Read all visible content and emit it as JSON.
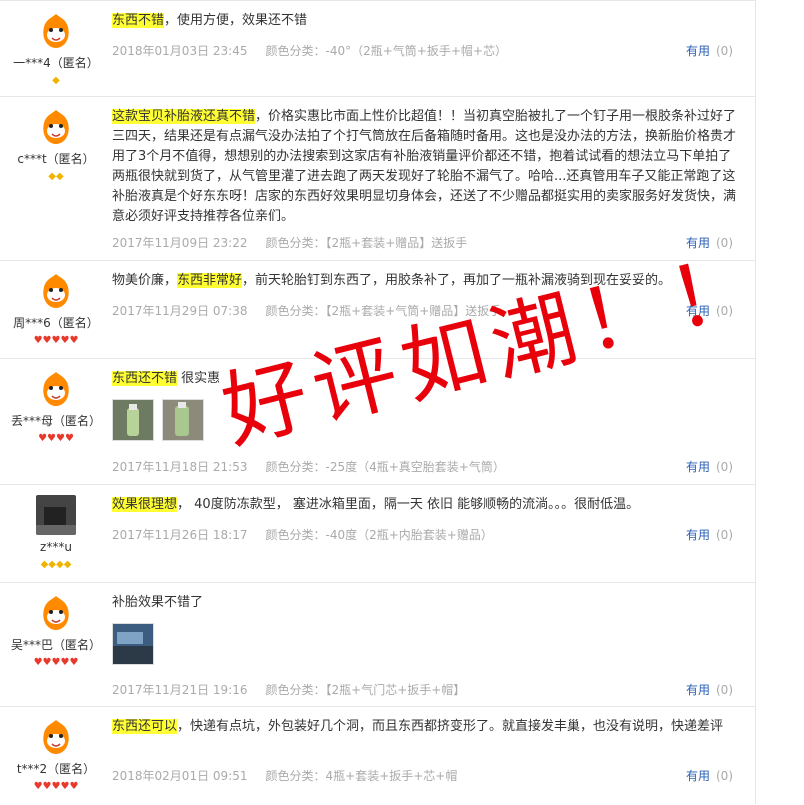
{
  "reviews": [
    {
      "user": "一***4（匿名）",
      "badge_type": "diamond",
      "badge_count": 1,
      "avatar": "orange-mascot-avatar",
      "highlight": "东西不错",
      "text": "，使用方便，效果还不错",
      "prefix": "",
      "date": "2018年01月03日 23:45",
      "color_label": "颜色分类：",
      "color": "-40°（2瓶+气筒+扳手+帽+芯）",
      "useful_label": "有用",
      "useful_count": "(0)"
    },
    {
      "user": "c***t（匿名）",
      "badge_type": "diamond",
      "badge_count": 2,
      "avatar": "orange-mascot-avatar",
      "highlight": "这款宝贝补胎液还真不错",
      "text": "，价格实惠比市面上性价比超值！！当初真空胎被扎了一个钉子用一根胶条补过好了三四天，结果还是有点漏气没办法拍了个打气筒放在后备箱随时备用。这也是没办法的方法，换新胎价格贵才用了3个月不值得，想想别的办法搜索到这家店有补胎液销量评价都还不错，抱着试试看的想法立马下单拍了两瓶很快就到货了，从气管里灌了进去跑了两天发现好了轮胎不漏气了。哈哈...还真管用车子又能正常跑了这补胎液真是个好东东呀！店家的东西好效果明显切身体会，还送了不少赠品都挺实用的卖家服务好发货快，满意必须好评支持推荐各位亲们。",
      "prefix": "",
      "date": "2017年11月09日 23:22",
      "color_label": "颜色分类：",
      "color": "【2瓶+套装+赠品】送扳手",
      "useful_label": "有用",
      "useful_count": "(0)"
    },
    {
      "user": "周***6（匿名）",
      "badge_type": "heart",
      "badge_count": 5,
      "avatar": "orange-mascot-avatar",
      "prefix": "物美价廉，",
      "highlight": "东西非常好",
      "text": "，前天轮胎钉到东西了，用胶条补了，再加了一瓶补漏液骑到现在妥妥的。",
      "date": "2017年11月29日 07:38",
      "color_label": "颜色分类：",
      "color": "【2瓶+套装+气筒+赠品】送扳手",
      "useful_label": "有用",
      "useful_count": "(0)"
    },
    {
      "user": "丢***母（匿名）",
      "badge_type": "heart",
      "badge_count": 4,
      "avatar": "orange-mascot-avatar",
      "prefix": "",
      "highlight": "东西还不错",
      "text": " 很实惠",
      "thumbs": [
        "product-photo-thumbnail",
        "product-photo-thumbnail"
      ],
      "date": "2017年11月18日 21:53",
      "color_label": "颜色分类：",
      "color": "-25度（4瓶+真空胎套装+气筒）",
      "useful_label": "有用",
      "useful_count": "(0)"
    },
    {
      "user": "z***u",
      "badge_type": "diamond",
      "badge_count": 4,
      "avatar": "user-photo-avatar",
      "prefix": "",
      "highlight": "效果很理想",
      "text": "， 40度防冻款型， 塞进冰箱里面，隔一天 依旧 能够顺畅的流淌。。。很耐低温。",
      "date": "2017年11月26日 18:17",
      "color_label": "颜色分类：",
      "color": "-40度（2瓶+内胎套装+赠品）",
      "useful_label": "有用",
      "useful_count": "(0)"
    },
    {
      "user": "吴***巴（匿名）",
      "badge_type": "heart",
      "badge_count": 5,
      "avatar": "orange-mascot-avatar",
      "prefix": "补胎效果不错了",
      "highlight": "",
      "text": "",
      "thumbs": [
        "tire-photo-thumbnail"
      ],
      "date": "2017年11月21日 19:16",
      "color_label": "颜色分类：",
      "color": "【2瓶+气门芯+扳手+帽】",
      "useful_label": "有用",
      "useful_count": "(0)"
    },
    {
      "user": "t***2（匿名）",
      "badge_type": "heart",
      "badge_count": 5,
      "avatar": "orange-mascot-avatar",
      "prefix": "",
      "highlight": "东西还可以",
      "text": "，快递有点坑，外包装好几个洞，而且东西都挤变形了。就直接发丰巢，也没有说明，快递差评",
      "date": "2018年02月01日 09:51",
      "color_label": "颜色分类：",
      "color": "4瓶+套装+扳手+芯+帽",
      "useful_label": "有用",
      "useful_count": "(0)"
    }
  ],
  "stamp": {
    "text": "好评如潮！！！",
    "color": "#e8000b"
  }
}
